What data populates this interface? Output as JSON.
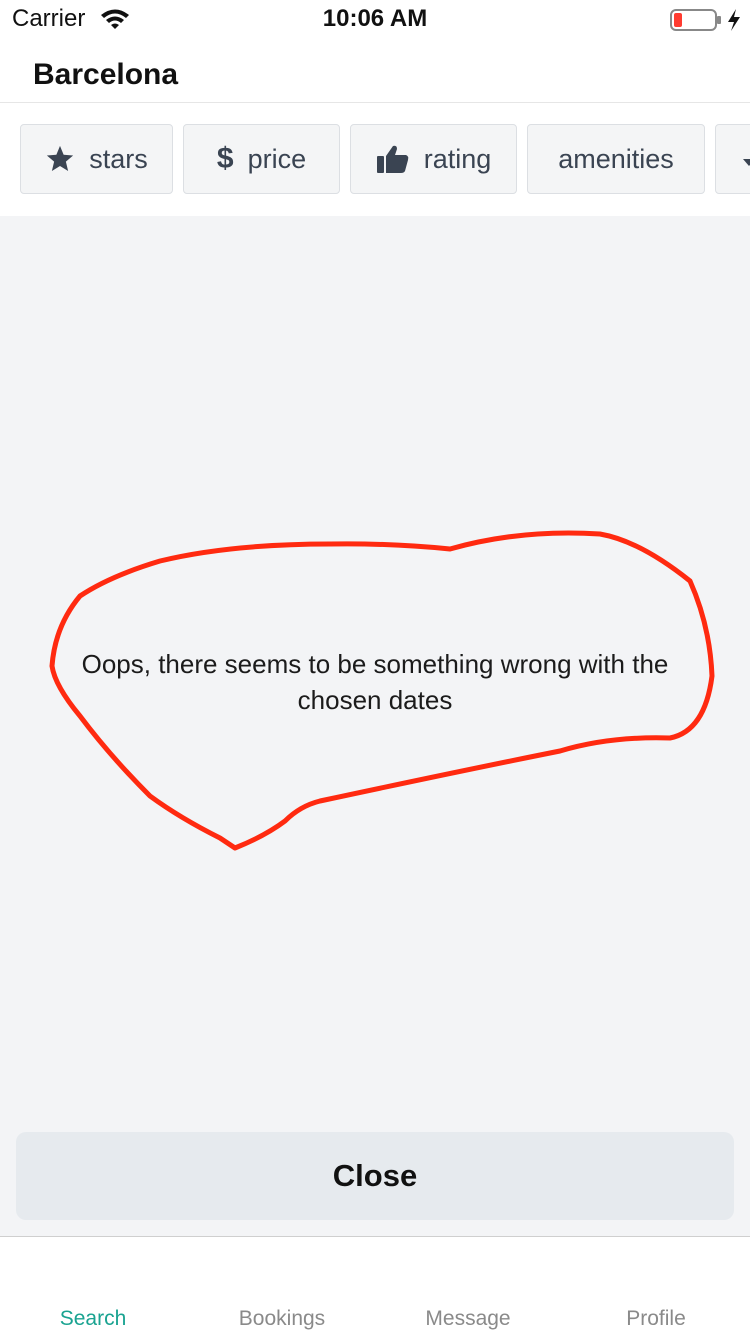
{
  "status_bar": {
    "carrier": "Carrier",
    "time": "10:06 AM"
  },
  "header": {
    "title": "Barcelona"
  },
  "filters": [
    {
      "label": "stars",
      "icon": "star-icon"
    },
    {
      "label": "price",
      "icon": "dollar-icon"
    },
    {
      "label": "rating",
      "icon": "thumbs-up-icon"
    },
    {
      "label": "amenities",
      "icon": ""
    }
  ],
  "main": {
    "message": "Oops, there seems to be something wrong with the chosen dates",
    "close_label": "Close",
    "annotation_color": "#ff2a10"
  },
  "tabs": [
    {
      "label": "Search",
      "active": true
    },
    {
      "label": "Bookings",
      "active": false
    },
    {
      "label": "Message",
      "active": false
    },
    {
      "label": "Profile",
      "active": false
    }
  ],
  "colors": {
    "accent": "#1aa391",
    "background": "#f3f4f6",
    "chip": "#f4f5f6"
  }
}
